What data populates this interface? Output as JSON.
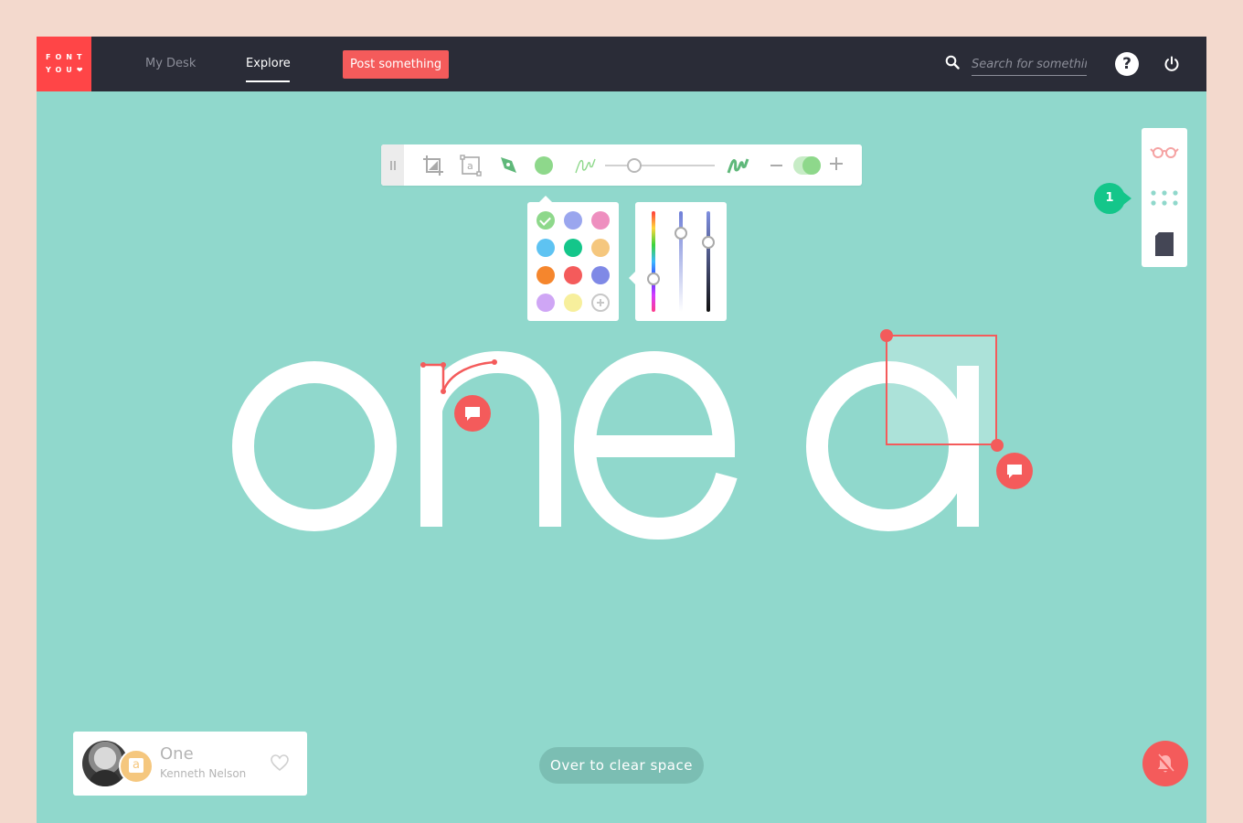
{
  "logo": {
    "line1": "FONT",
    "line2": "YOU❤"
  },
  "nav": {
    "items": [
      {
        "label": "My Desk",
        "active": false
      },
      {
        "label": "Explore",
        "active": true
      }
    ],
    "post_button": "Post something"
  },
  "search": {
    "placeholder": "Search for something",
    "icon": "search-icon"
  },
  "header_actions": {
    "help_label": "?",
    "help_icon": "help-icon",
    "power_icon": "power-icon"
  },
  "toolbar": {
    "tools": [
      "crop-icon",
      "text-box-icon",
      "pen-tool-icon",
      "color-swatch",
      "thin-brush-icon",
      "size-slider",
      "thick-brush-icon",
      "zoom-minus",
      "toggle",
      "zoom-plus"
    ],
    "current_color": "#8ed88b",
    "brush_size_fraction": 0.27,
    "toggle_on": true
  },
  "palette": {
    "colors": [
      "#8ed88b",
      "#9aa6ee",
      "#ee8fbf",
      "#5ec3f2",
      "#14c68a",
      "#f5c77e",
      "#f5862d",
      "#f45b5b",
      "#7f89e6",
      "#cfa6f5",
      "#f7ef9c"
    ],
    "selected": "#8ed88b",
    "add_icon": "add-color-icon"
  },
  "color_sliders": {
    "hue": 0.67,
    "lightness": 0.2,
    "darkness": 0.3
  },
  "side_panel": {
    "icons": [
      "glasses-icon",
      "grid-dots-icon",
      "document-icon"
    ],
    "badge_count": "1"
  },
  "canvas": {
    "text": "one a",
    "glyph_color": "#ffffff",
    "accent_color": "#f45b5b",
    "comment_icon": "comment-icon"
  },
  "card": {
    "title": "One",
    "author": "Kenneth Nelson",
    "glyph": "a",
    "heart_icon": "heart-icon"
  },
  "clear_space": "Over to clear space",
  "mute_icon": "bell-off-icon"
}
